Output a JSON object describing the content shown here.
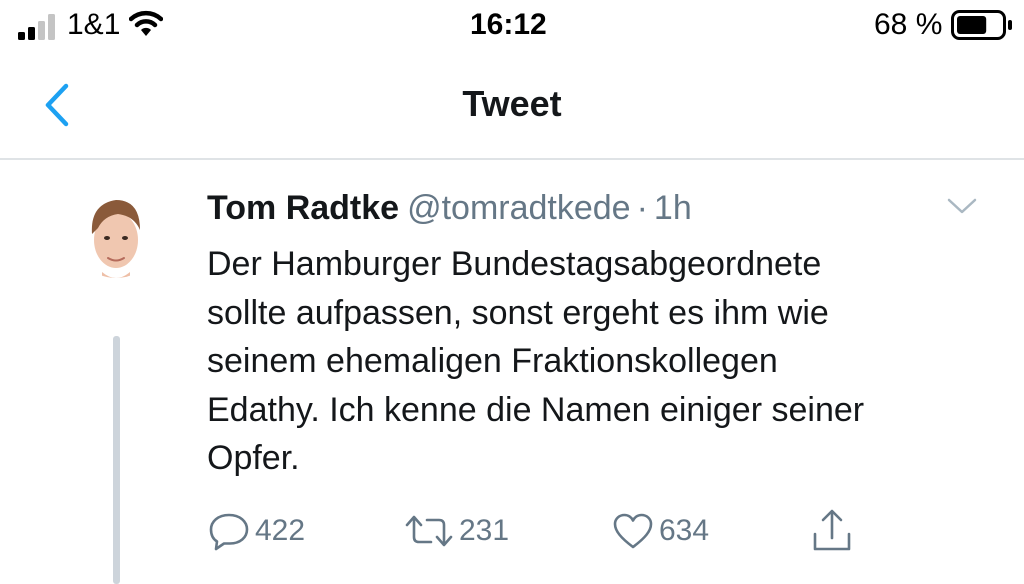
{
  "status_bar": {
    "carrier": "1&1",
    "time": "16:12",
    "battery_percent": "68 %",
    "battery_level": 0.68,
    "signal_bars_active": 2,
    "signal_bars_total": 4
  },
  "nav": {
    "back_icon": "chevron-left-icon",
    "title": "Tweet",
    "accent_color": "#1da1f2"
  },
  "tweet": {
    "author_name": "Tom Radtke",
    "author_handle": "@tomradtkede",
    "separator": "·",
    "time_ago": "1h",
    "text_lines": [
      "Der Hamburger Bundestagsabgeordnete",
      "sollte aufpassen, sonst ergeht es ihm wie",
      "seinem ehemaligen Fraktionskollegen",
      "Edathy. Ich kenne die Namen einiger seiner",
      "Opfer."
    ],
    "actions": {
      "reply_count": "422",
      "retweet_count": "231",
      "like_count": "634"
    },
    "colors": {
      "text": "#14171a",
      "secondary": "#657786",
      "thread_line": "#cdd4db",
      "divider": "#dfe3e6"
    }
  }
}
